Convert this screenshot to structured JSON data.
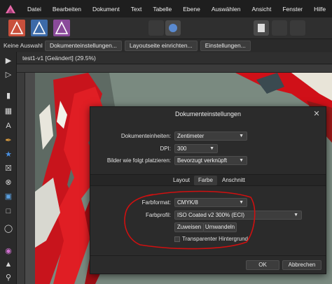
{
  "menu": {
    "items": [
      "Datei",
      "Bearbeiten",
      "Dokument",
      "Text",
      "Tabelle",
      "Ebene",
      "Auswählen",
      "Ansicht",
      "Fenster",
      "Hilfe"
    ]
  },
  "context": {
    "selection_label": "Keine Auswahl",
    "buttons": [
      "Dokumenteinstellungen...",
      "Layoutseite einrichten...",
      "Einstellungen..."
    ]
  },
  "document": {
    "tab_title": "test1-v1 [Geändert] (29.5%)"
  },
  "dialog": {
    "title": "Dokumenteinstellungen",
    "close_icon": "close-icon",
    "units_label": "Dokumenteinheiten:",
    "units_value": "Zentimeter",
    "dpi_label": "DPI:",
    "dpi_value": "300",
    "place_label": "Bilder wie folgt platzieren:",
    "place_value": "Bevorzugt verknüpft",
    "tabs": [
      "Layout",
      "Farbe",
      "Anschnitt"
    ],
    "active_tab": "Farbe",
    "color_format_label": "Farbformat:",
    "color_format_value": "CMYK/8",
    "color_profile_label": "Farbprofil:",
    "color_profile_value": "ISO Coated v2 300% (ECI)",
    "assign_button": "Zuweisen",
    "convert_button": "Umwandeln",
    "transparent_label": "Transparenter Hintergrund",
    "transparent_checked": false,
    "ok_button": "OK",
    "cancel_button": "Abbrechen"
  },
  "colors": {
    "annotation_circle": "#d01010",
    "menubar_bg": "#1e1e1e",
    "dialog_bg": "#2b2b2b"
  }
}
